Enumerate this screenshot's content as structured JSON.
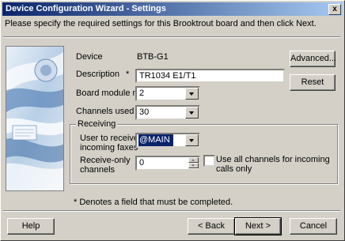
{
  "window": {
    "title": "Device Configuration Wizard - Settings",
    "close_glyph": "x"
  },
  "instructions": "Please specify the required settings for this Brooktrout board and then click Next.",
  "device": {
    "label": "Device",
    "value": "BTB-G1"
  },
  "description": {
    "label": "Description",
    "required_mark": "*",
    "value": "TR1034 E1/T1"
  },
  "board_module": {
    "label": "Board module no",
    "value": "2"
  },
  "channels_used": {
    "label": "Channels used",
    "value": "30"
  },
  "receiving": {
    "group_label": "Receiving",
    "user_label_line1": "User to receive",
    "user_label_line2": "incoming faxes",
    "user_value": "@MAIN",
    "receive_only_label_line1": "Receive-only",
    "receive_only_label_line2": "channels",
    "receive_only_value": "0",
    "all_channels_line1": "Use all channels for incoming",
    "all_channels_line2": "calls only",
    "all_channels_checked": false
  },
  "side_buttons": {
    "advanced": "Advanced...",
    "reset": "Reset"
  },
  "footnote": "* Denotes a field that must be completed.",
  "footer": {
    "help": "Help",
    "back": "< Back",
    "next": "Next >",
    "cancel": "Cancel"
  }
}
